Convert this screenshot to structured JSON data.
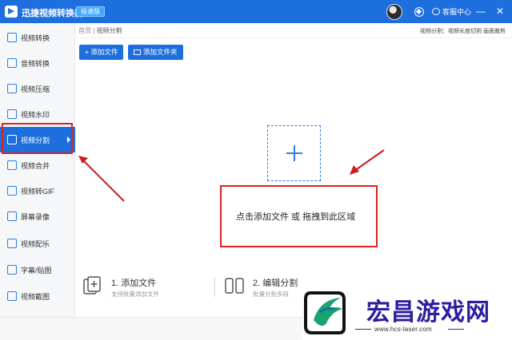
{
  "app": {
    "title": "迅捷视频转换器",
    "edition_badge": "极速版",
    "service_label": "客服中心",
    "minimize_glyph": "—",
    "close_glyph": "✕",
    "icons": [
      "avatar",
      "vip-icon",
      "chat-icon",
      "minimize-icon",
      "close-icon"
    ]
  },
  "sidebar": {
    "items": [
      {
        "label": "视频转换",
        "icon": "video-convert-icon"
      },
      {
        "label": "音频转换",
        "icon": "audio-convert-icon"
      },
      {
        "label": "视频压缩",
        "icon": "compress-icon"
      },
      {
        "label": "视频水印",
        "icon": "watermark-icon"
      },
      {
        "label": "视频分割",
        "icon": "split-icon",
        "active": true
      },
      {
        "label": "视频合并",
        "icon": "merge-icon"
      },
      {
        "label": "视频转GIF",
        "icon": "gif-icon"
      },
      {
        "label": "屏幕录像",
        "icon": "record-icon"
      },
      {
        "label": "视频配乐",
        "icon": "music-icon"
      },
      {
        "label": "字幕/贴图",
        "icon": "subtitle-icon"
      },
      {
        "label": "视频截图",
        "icon": "screenshot-icon"
      }
    ]
  },
  "breadcrumb": {
    "home": "首页",
    "separator": "|",
    "current": "视频分割"
  },
  "top_hint": "视频分割：视频长度切割 画面裁剪",
  "toolbar": {
    "add_file": "+ 添加文件",
    "add_folder": "添加文件夹"
  },
  "dropzone": {
    "hint": "点击添加文件 或 拖拽到此区域"
  },
  "steps": [
    {
      "title": "1. 添加文件",
      "desc": "支持批量添加文件"
    },
    {
      "title": "2. 编辑分割",
      "desc": "批量分割多段"
    }
  ],
  "watermark": {
    "name": "宏昌游戏网",
    "url": "www.hcs-laser.com"
  },
  "colors": {
    "accent": "#1e6fde",
    "annotation": "#e02020",
    "watermark_text": "#2b1fa0"
  }
}
